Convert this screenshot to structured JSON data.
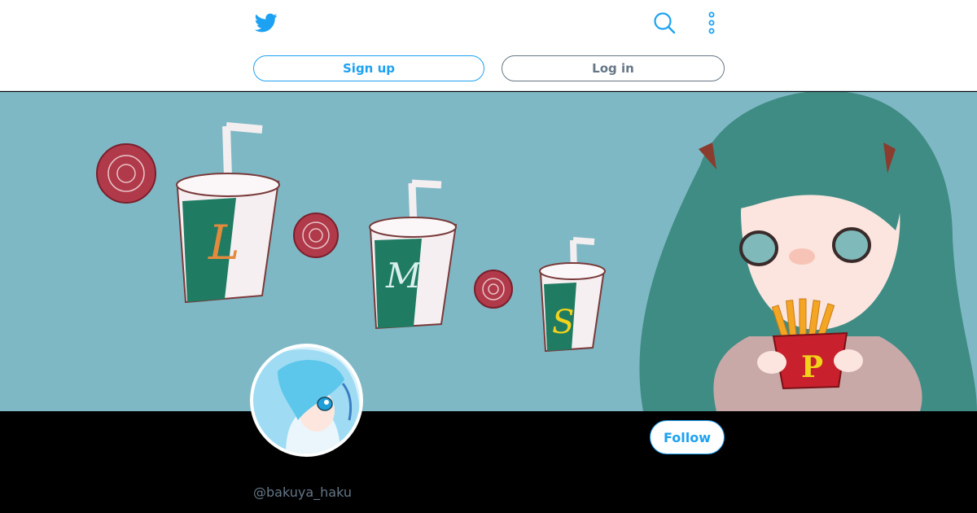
{
  "header": {
    "logo_icon": "twitter-bird-icon",
    "title": "　　",
    "search_icon": "search-icon",
    "more_icon": "more-vertical-icon",
    "signup_label": "Sign up",
    "login_label": "Log in"
  },
  "banner": {
    "cup_letters": [
      "L",
      "M",
      "S"
    ],
    "fries_letter": "P"
  },
  "profile": {
    "follow_label": "Follow",
    "handle": "@bakuya_haku"
  },
  "colors": {
    "brand": "#1da1f2",
    "secondary_text": "#657786",
    "banner_bg": "#7fb8c5"
  }
}
